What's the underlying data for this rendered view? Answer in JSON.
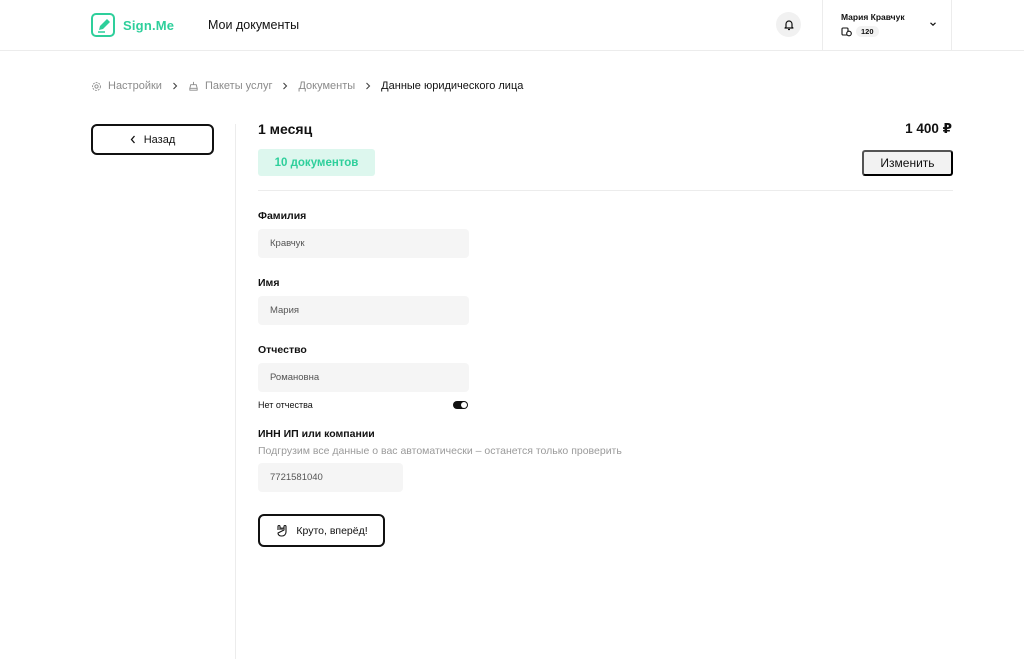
{
  "header": {
    "logo_text": "Sign.Me",
    "nav_link": "Мои документы",
    "user_name": "Мария Кравчук",
    "balance": "120"
  },
  "breadcrumb": {
    "items": [
      "Настройки",
      "Пакеты услуг",
      "Документы"
    ],
    "current": "Данные юридического лица"
  },
  "back_button": "Назад",
  "plan": {
    "title": "1 месяц",
    "price": "1 400 ₽",
    "badge": "10 документов",
    "change_label": "Изменить"
  },
  "form": {
    "last_name": {
      "label": "Фамилия",
      "value": "Кравчук"
    },
    "first_name": {
      "label": "Имя",
      "value": "Мария"
    },
    "patronymic": {
      "label": "Отчество",
      "value": "Романовна"
    },
    "no_patronymic": {
      "label": "Нет отчества",
      "enabled": true
    },
    "inn": {
      "label": "ИНН ИП или компании",
      "hint": "Подгрузим все данные о вас автоматически – останется только проверить",
      "value": "7721581040"
    },
    "submit_label": "Круто, вперёд!"
  },
  "colors": {
    "accent": "#2ecf9b",
    "badge_bg": "#ddf7ee",
    "input_bg": "#f5f5f5"
  },
  "icons": [
    "logo-pen-icon",
    "bell-icon",
    "coins-icon",
    "chevron-down-icon",
    "gear-icon",
    "package-icon",
    "chevron-right-icon",
    "chevron-left-icon",
    "rock-hand-icon"
  ]
}
